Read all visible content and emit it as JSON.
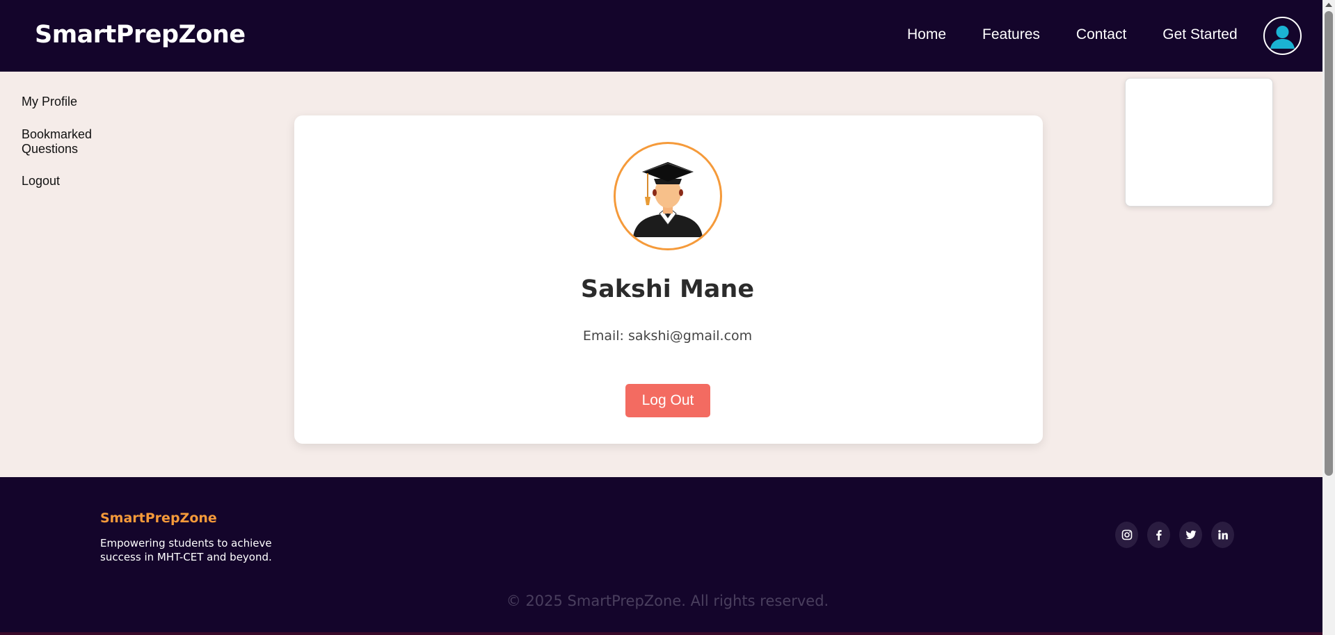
{
  "navbar": {
    "brand": "SmartPrepZone",
    "links": [
      "Home",
      "Features",
      "Contact",
      "Get Started"
    ],
    "profile_icon": "user-circle-icon"
  },
  "dropdown": {
    "items": [
      "My Profile",
      "Bookmarked Questions",
      "Logout"
    ]
  },
  "profile": {
    "avatar_icon": "graduate-avatar",
    "name": "Sakshi Mane",
    "email_label": "Email: sakshi@gmail.com",
    "logout_label": "Log Out"
  },
  "footer": {
    "brand": "SmartPrepZone",
    "tagline": "Empowering students to achieve success in MHT-CET and beyond.",
    "socials": [
      "instagram-icon",
      "facebook-icon",
      "twitter-icon",
      "linkedin-icon"
    ],
    "copyright": "© 2025 SmartPrepZone. All rights reserved."
  },
  "colors": {
    "nav_bg": "#14052b",
    "page_bg": "#f5ece9",
    "accent_orange": "#f59a3a",
    "logout_red": "#f36b61",
    "profile_icon_blue": "#1bb3d3"
  }
}
